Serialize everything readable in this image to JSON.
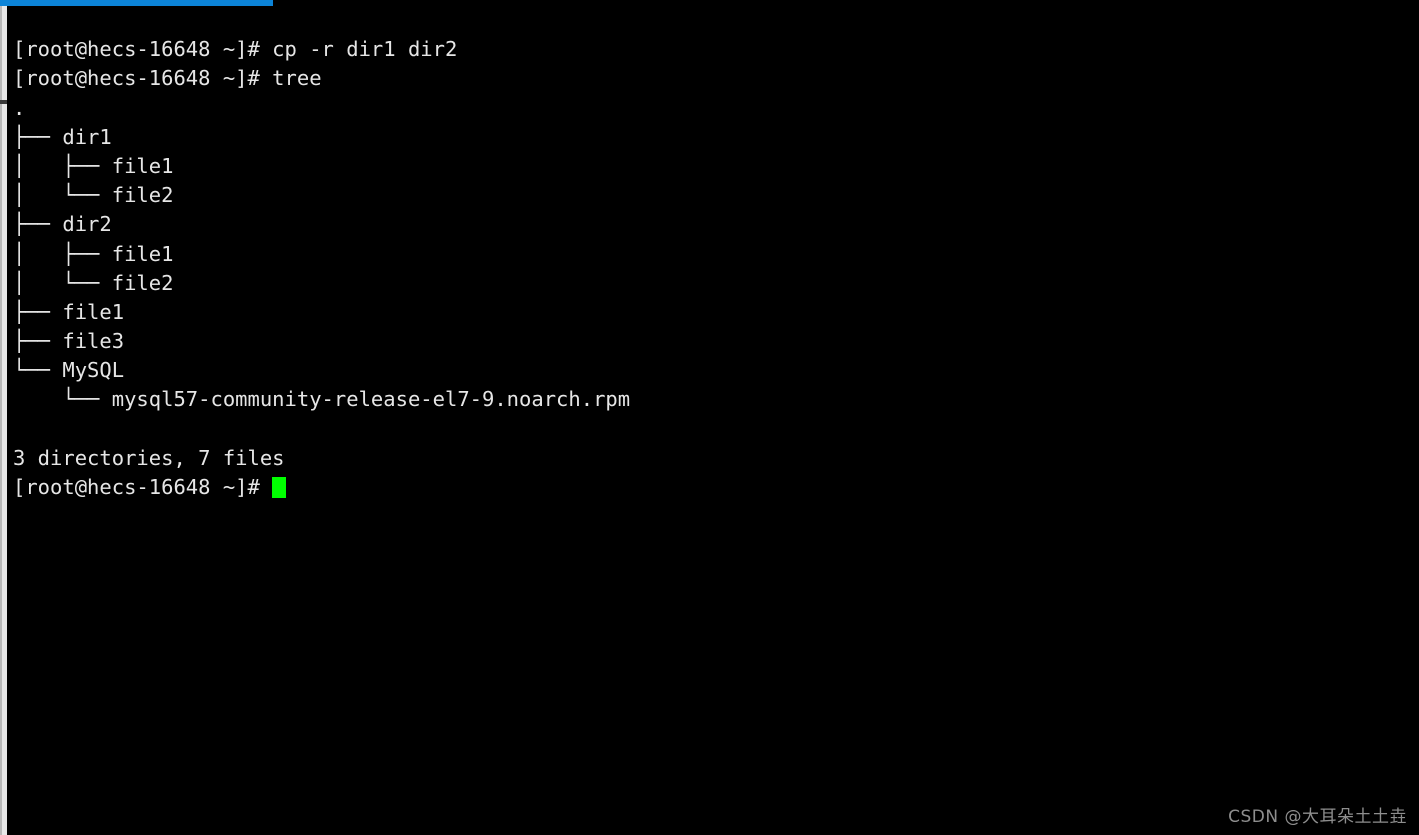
{
  "window": {
    "accent_color": "#0c84d8",
    "background_color": "#000000",
    "foreground_color": "#e6e6e6",
    "cursor_color": "#00ff00"
  },
  "terminal": {
    "prompt": "[root@hecs-16648 ~]# ",
    "lines": [
      "[root@hecs-16648 ~]# cp -r dir1 dir2",
      "[root@hecs-16648 ~]# tree",
      ".",
      "├── dir1",
      "│   ├── file1",
      "│   └── file2",
      "├── dir2",
      "│   ├── file1",
      "│   └── file2",
      "├── file1",
      "├── file3",
      "└── MySQL",
      "    └── mysql57-community-release-el7-9.noarch.rpm",
      "",
      "3 directories, 7 files"
    ],
    "final_prompt": "[root@hecs-16648 ~]# ",
    "commands": [
      "cp -r dir1 dir2",
      "tree"
    ],
    "tree_summary": {
      "directories": 3,
      "files": 7,
      "text": "3 directories, 7 files"
    },
    "tree_entries": [
      {
        "name": ".",
        "type": "root",
        "depth": 0
      },
      {
        "name": "dir1",
        "type": "directory",
        "depth": 1
      },
      {
        "name": "file1",
        "type": "file",
        "depth": 2
      },
      {
        "name": "file2",
        "type": "file",
        "depth": 2
      },
      {
        "name": "dir2",
        "type": "directory",
        "depth": 1
      },
      {
        "name": "file1",
        "type": "file",
        "depth": 2
      },
      {
        "name": "file2",
        "type": "file",
        "depth": 2
      },
      {
        "name": "file1",
        "type": "file",
        "depth": 1
      },
      {
        "name": "file3",
        "type": "file",
        "depth": 1
      },
      {
        "name": "MySQL",
        "type": "directory",
        "depth": 1
      },
      {
        "name": "mysql57-community-release-el7-9.noarch.rpm",
        "type": "file",
        "depth": 2
      }
    ]
  },
  "watermark": {
    "text": "CSDN @大耳朵土土垚"
  }
}
